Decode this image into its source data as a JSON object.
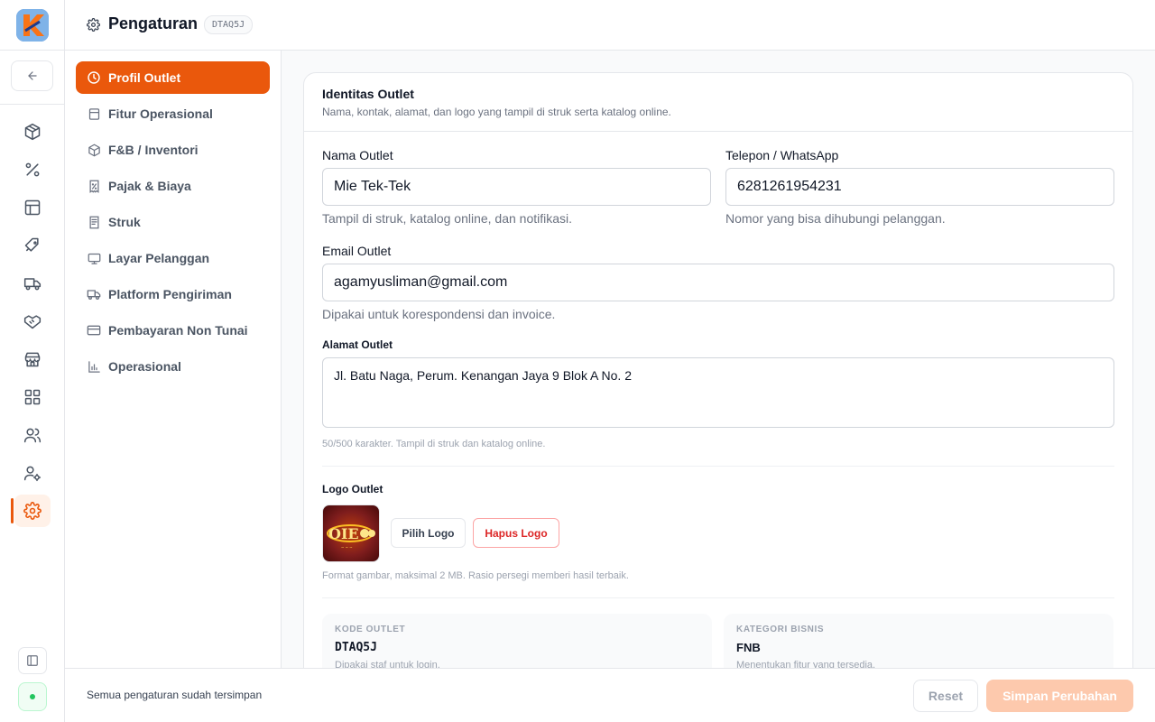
{
  "header": {
    "title": "Pengaturan",
    "outlet_code_badge": "DTAQ5J"
  },
  "rail": {
    "items": [
      {
        "icon": "box-icon"
      },
      {
        "icon": "percent-icon"
      },
      {
        "icon": "layout-icon"
      },
      {
        "icon": "tag-icon"
      },
      {
        "icon": "truck-icon"
      },
      {
        "icon": "handshake-icon"
      },
      {
        "icon": "store-icon"
      },
      {
        "icon": "grid-icon"
      },
      {
        "icon": "users-icon"
      },
      {
        "icon": "user-settings-icon"
      },
      {
        "icon": "settings-icon",
        "active": true
      }
    ]
  },
  "settings_nav": {
    "items": [
      {
        "label": "Profil Outlet",
        "icon": "clock-icon",
        "active": true
      },
      {
        "label": "Fitur Operasional",
        "icon": "archive-icon"
      },
      {
        "label": "F&B / Inventori",
        "icon": "package-icon"
      },
      {
        "label": "Pajak & Biaya",
        "icon": "receipt-percent-icon"
      },
      {
        "label": "Struk",
        "icon": "receipt-icon"
      },
      {
        "label": "Layar Pelanggan",
        "icon": "monitor-icon"
      },
      {
        "label": "Platform Pengiriman",
        "icon": "truck-icon"
      },
      {
        "label": "Pembayaran Non Tunai",
        "icon": "credit-card-icon"
      },
      {
        "label": "Operasional",
        "icon": "bar-chart-icon"
      }
    ]
  },
  "card": {
    "title": "Identitas Outlet",
    "subtitle": "Nama, kontak, alamat, dan logo yang tampil di struk serta katalog online.",
    "name": {
      "label": "Nama Outlet",
      "value": "Mie Tek-Tek",
      "hint": "Tampil di struk, katalog online, dan notifikasi."
    },
    "phone": {
      "label": "Telepon / WhatsApp",
      "value": "6281261954231",
      "hint": "Nomor yang bisa dihubungi pelanggan."
    },
    "email": {
      "label": "Email Outlet",
      "value": "agamyusliman@gmail.com",
      "hint": "Dipakai untuk korespondensi dan invoice."
    },
    "address": {
      "label": "Alamat Outlet",
      "value": "Jl. Batu Naga, Perum. Kenangan Jaya 9 Blok A No. 2",
      "hint": "50/500 karakter. Tampil di struk dan katalog online."
    },
    "logo": {
      "label": "Logo Outlet",
      "choose_label": "Pilih Logo",
      "delete_label": "Hapus Logo",
      "hint": "Format gambar, maksimal 2 MB. Rasio persegi memberi hasil terbaik."
    },
    "outlet_code": {
      "label": "KODE OUTLET",
      "value": "DTAQ5J",
      "hint": "Dipakai staf untuk login."
    },
    "business_category": {
      "label": "KATEGORI BISNIS",
      "value": "FNB",
      "hint": "Menentukan fitur yang tersedia."
    }
  },
  "footer": {
    "status": "Semua pengaturan sudah tersimpan",
    "reset_label": "Reset",
    "save_label": "Simpan Perubahan"
  },
  "colors": {
    "accent": "#ea580c",
    "accent_light": "#fdc9ad",
    "danger": "#dc2626"
  }
}
